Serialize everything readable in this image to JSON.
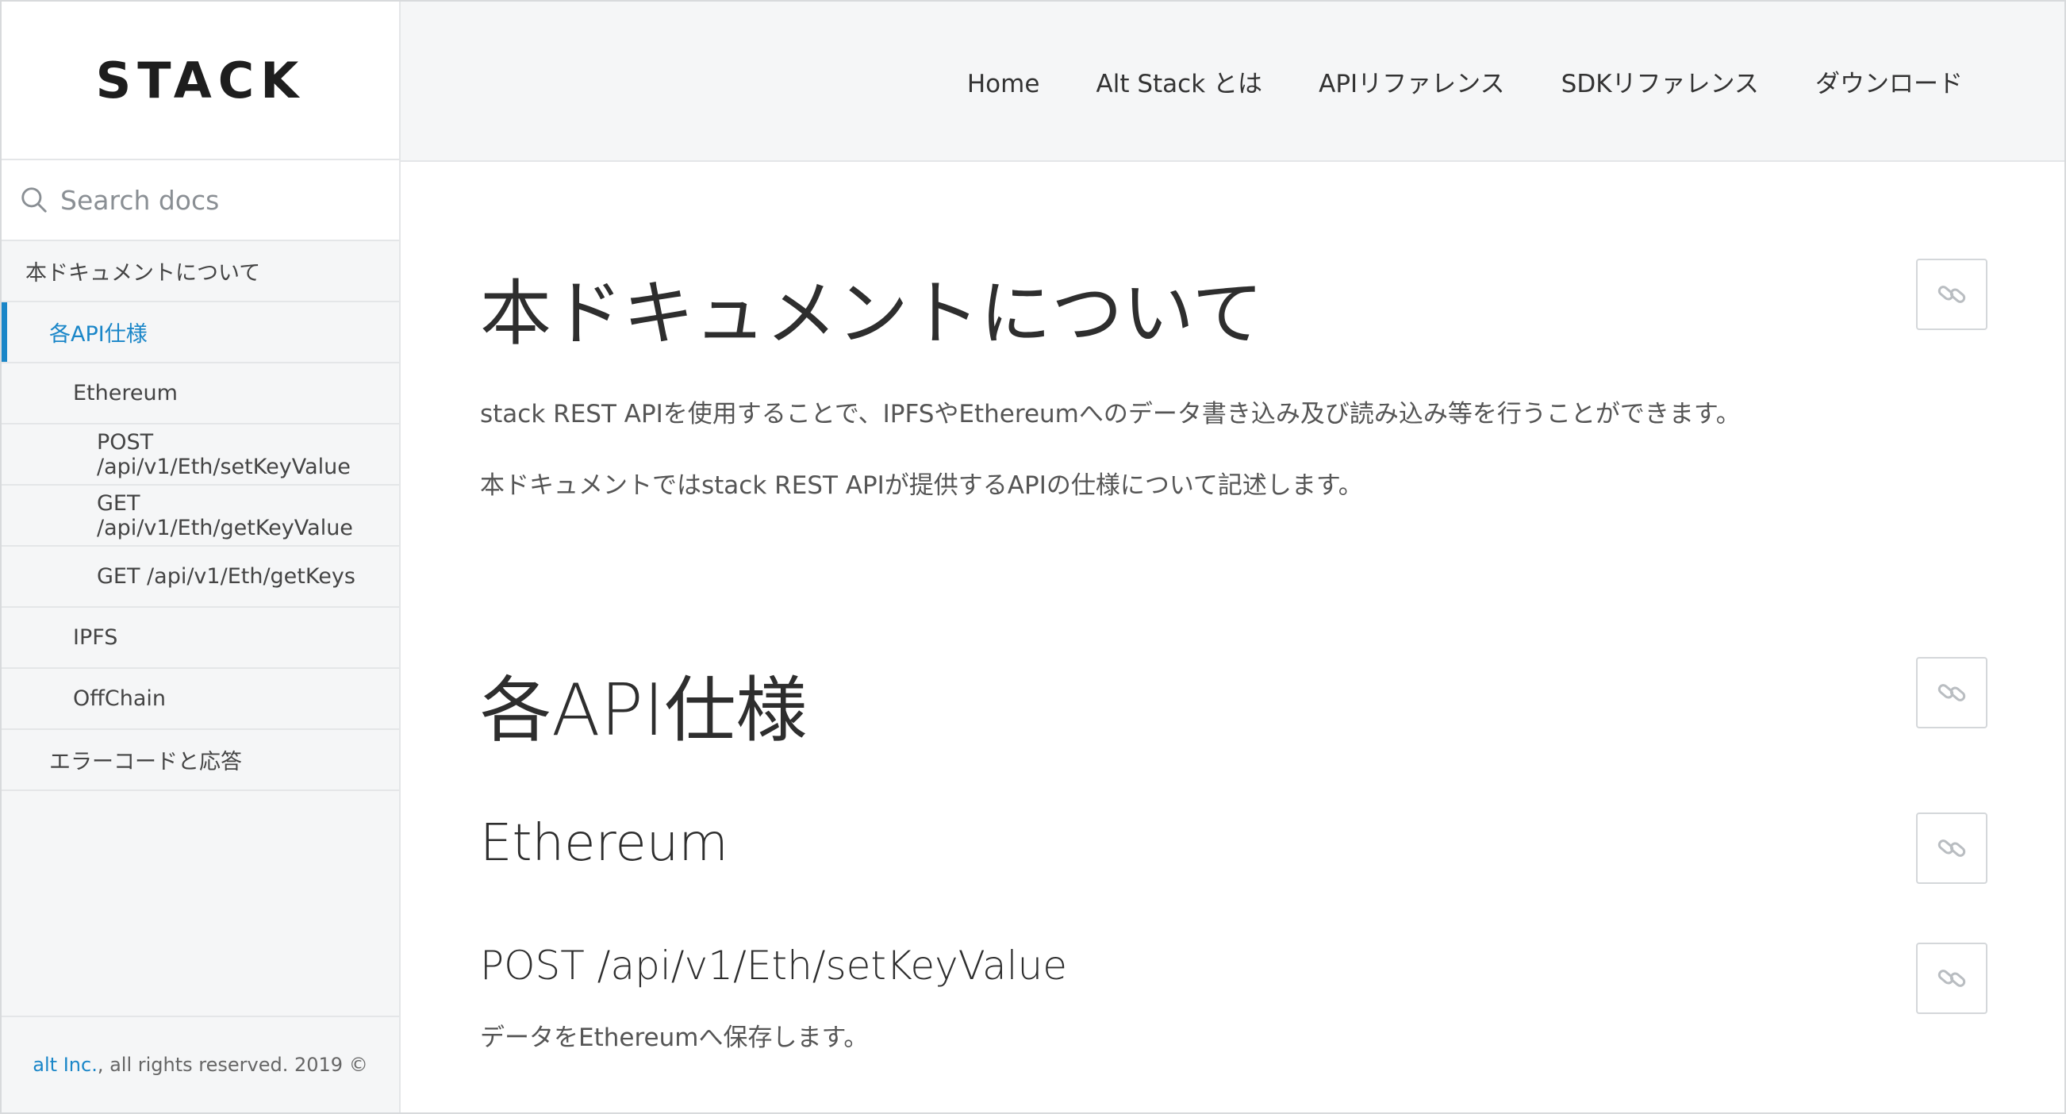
{
  "logo": "STACK",
  "search": {
    "placeholder": "Search docs"
  },
  "sidebar": {
    "items": [
      {
        "label": "本ドキュメントについて"
      },
      {
        "label": "各API仕様"
      },
      {
        "label": "Ethereum"
      },
      {
        "label": "POST /api/v1/Eth/setKeyValue"
      },
      {
        "label": "GET /api/v1/Eth/getKeyValue"
      },
      {
        "label": "GET /api/v1/Eth/getKeys"
      },
      {
        "label": "IPFS"
      },
      {
        "label": "OffChain"
      },
      {
        "label": "エラーコードと応答"
      }
    ],
    "footer": {
      "company": "alt Inc.",
      "rights": ", all rights reserved. 2019 ©"
    }
  },
  "header": {
    "nav": [
      "Home",
      "Alt Stack とは",
      "APIリファレンス",
      "SDKリファレンス",
      "ダウンロード"
    ]
  },
  "content": {
    "h1_about": "本ドキュメントについて",
    "p1": "stack REST APIを使用することで、IPFSやEthereumへのデータ書き込み及び読み込み等を行うことができます。",
    "p2": "本ドキュメントではstack REST APIが提供するAPIの仕様について記述します。",
    "h1_api": "各API仕様",
    "h2_eth": "Ethereum",
    "h3_post": "POST /api/v1/Eth/setKeyValue",
    "p3": "データをEthereumへ保存します。"
  },
  "colors": {
    "accent": "#1a86c8",
    "sidebar_bg": "#f5f6f7",
    "header_bg": "#f5f6f7"
  },
  "icons": {
    "search": "search-icon",
    "anchor": "link-icon"
  }
}
